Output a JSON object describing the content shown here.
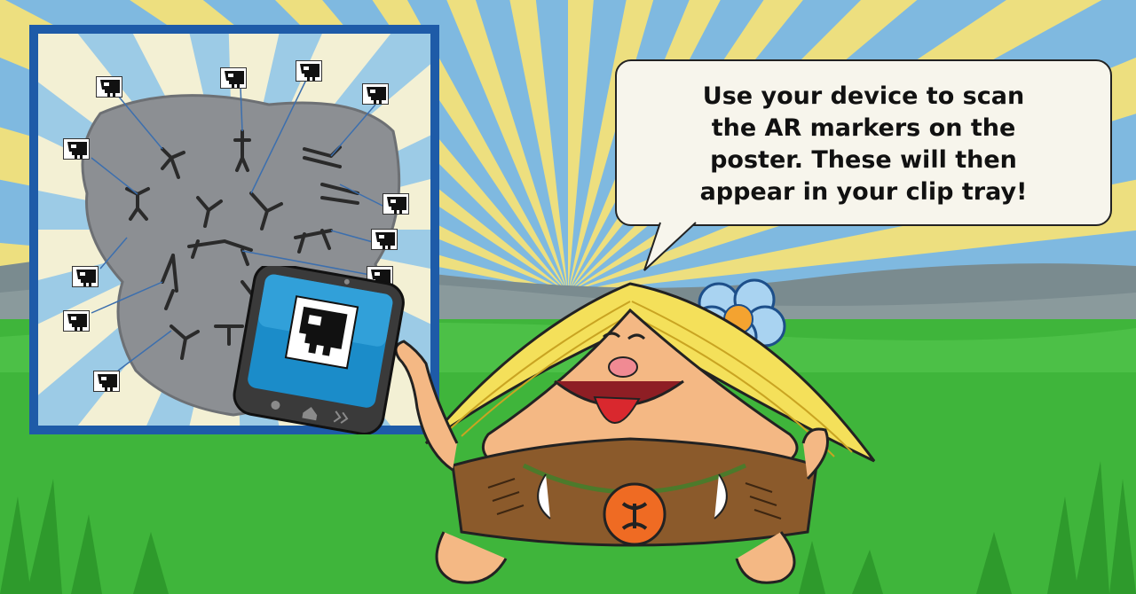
{
  "speech_bubble": {
    "lines": [
      "Use your device to scan",
      "the AR markers on the",
      "poster. These will then",
      "appear in your clip tray!"
    ]
  },
  "colors": {
    "sky": "#7fb9e0",
    "ray": "#f3e27a",
    "grass": "#3fb53b",
    "poster_frame": "#1e5ba8",
    "bubble_fill": "#f7f5ec"
  },
  "icons": {
    "poster": "cave-painting-poster",
    "markers": "ar-marker-icon",
    "device": "tablet-device",
    "character": "caveman-character"
  }
}
